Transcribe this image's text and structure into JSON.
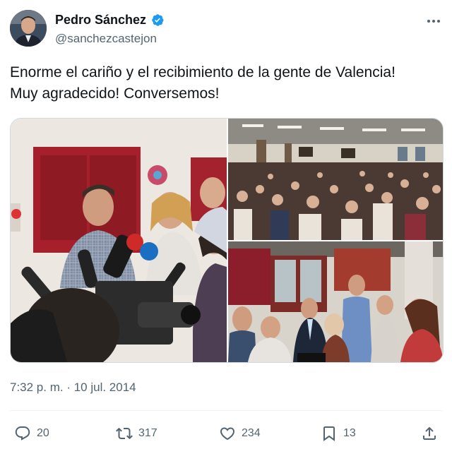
{
  "author": {
    "name": "Pedro Sánchez",
    "handle": "@sanchezcastejon",
    "verified": true
  },
  "tweet": {
    "text": "Enorme el cariño y el recibimiento de la gente de Valencia!\nMuy agradecido! Conversemos!",
    "timestamp": "7:32 p. m. · 10 jul. 2014"
  },
  "media": {
    "photos": [
      "press-microphones-photo",
      "auditorium-crowd-photo",
      "crowd-greeting-photo"
    ]
  },
  "actions": {
    "replies": "20",
    "retweets": "317",
    "likes": "234",
    "bookmarks": "13"
  },
  "colors": {
    "text_primary": "#0f1419",
    "text_secondary": "#536471",
    "verified_blue": "#1d9bf0",
    "border": "#cfd9de"
  }
}
